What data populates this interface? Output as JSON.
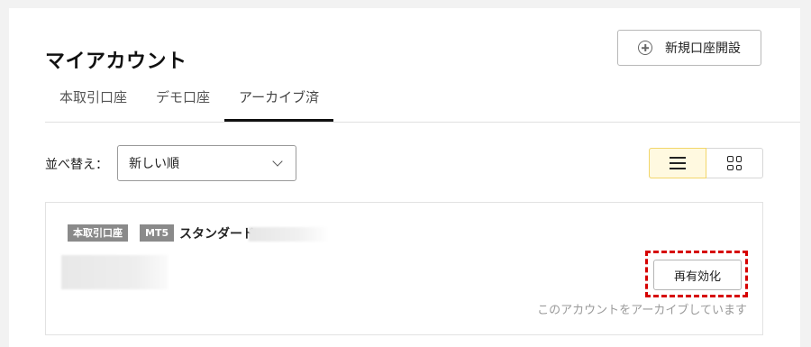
{
  "header": {
    "title": "マイアカウント",
    "new_account_label": "新規口座開設"
  },
  "tabs": [
    {
      "label": "本取引口座",
      "active": false
    },
    {
      "label": "デモ口座",
      "active": false
    },
    {
      "label": "アーカイブ済",
      "active": true
    }
  ],
  "sort": {
    "label": "並べ替え：",
    "selected": "新しい順"
  },
  "view_toggle": {
    "selected": "list",
    "options": [
      "list-icon",
      "grid-icon"
    ]
  },
  "account": {
    "type_badge": "本取引口座",
    "platform_badge": "MT5",
    "plan": "スタンダード",
    "reactivate_label": "再有効化",
    "archived_note": "このアカウントをアーカイブしています"
  },
  "colors": {
    "highlight": "#d60000",
    "selected_view_bg": "#fff9e0",
    "badge_bg": "#8a8a8a"
  }
}
